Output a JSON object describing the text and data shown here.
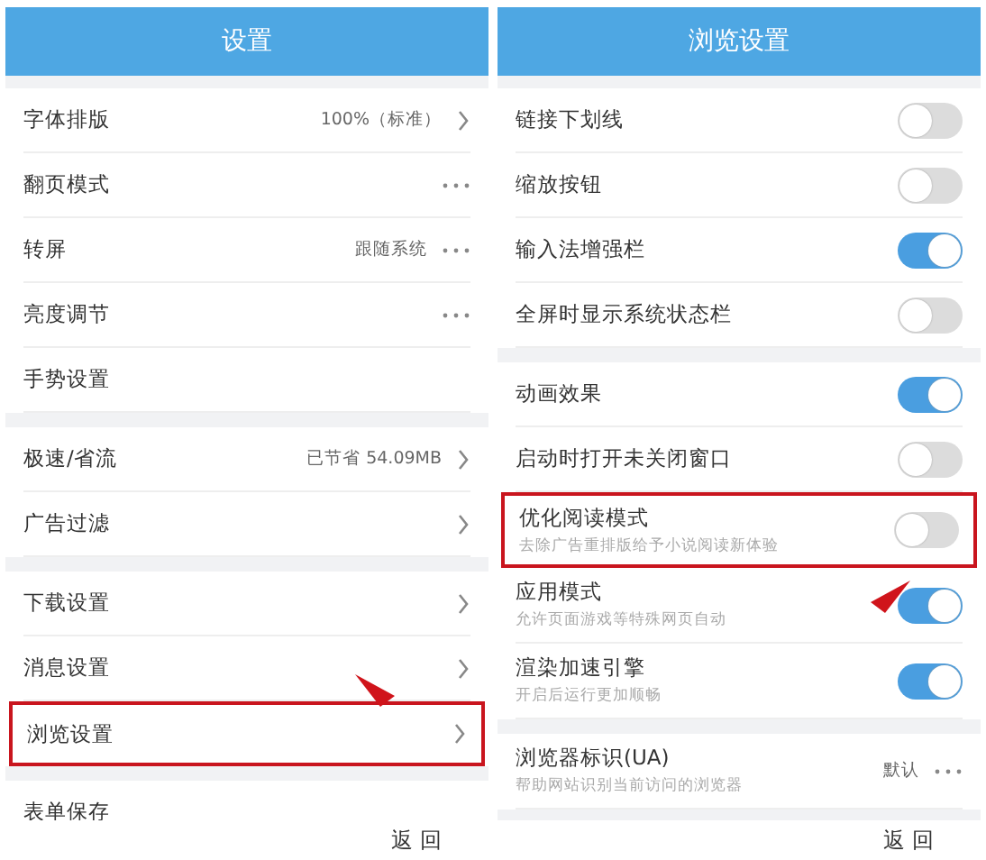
{
  "panels": [
    {
      "title": "设置",
      "footer": "返 回",
      "sections": [
        {
          "rows": [
            {
              "kind": "link",
              "label": "字体排版",
              "value": "100%（标准）",
              "highlighted": false
            },
            {
              "kind": "menu",
              "label": "翻页模式",
              "highlighted": false
            },
            {
              "kind": "menu",
              "label": "转屏",
              "value": "跟随系统",
              "highlighted": false
            },
            {
              "kind": "menu",
              "label": "亮度调节",
              "highlighted": false
            },
            {
              "kind": "plain",
              "label": "手势设置",
              "highlighted": false
            }
          ]
        },
        {
          "rows": [
            {
              "kind": "link",
              "label": "极速/省流",
              "value": "已节省 54.09MB",
              "highlighted": false
            },
            {
              "kind": "link",
              "label": "广告过滤",
              "highlighted": false
            }
          ]
        },
        {
          "rows": [
            {
              "kind": "link",
              "label": "下载设置",
              "highlighted": false
            },
            {
              "kind": "link",
              "label": "消息设置",
              "highlighted": false
            },
            {
              "kind": "link",
              "label": "浏览设置",
              "highlighted": true
            }
          ]
        },
        {
          "rows": [
            {
              "kind": "plain",
              "label": "表单保存",
              "highlighted": false
            }
          ]
        }
      ]
    },
    {
      "title": "浏览设置",
      "footer": "返 回",
      "sections": [
        {
          "rows": [
            {
              "kind": "toggle",
              "label": "链接下划线",
              "on": false,
              "highlighted": false
            },
            {
              "kind": "toggle",
              "label": "缩放按钮",
              "on": false,
              "highlighted": false
            },
            {
              "kind": "toggle",
              "label": "输入法增强栏",
              "on": true,
              "highlighted": false
            },
            {
              "kind": "toggle",
              "label": "全屏时显示系统状态栏",
              "on": false,
              "highlighted": false
            }
          ]
        },
        {
          "rows": [
            {
              "kind": "toggle",
              "label": "动画效果",
              "on": true,
              "highlighted": false
            },
            {
              "kind": "toggle",
              "label": "启动时打开未关闭窗口",
              "on": false,
              "highlighted": false
            },
            {
              "kind": "toggle",
              "label": "优化阅读模式",
              "sublabel": "去除广告重排版给予小说阅读新体验",
              "on": false,
              "highlighted": true
            },
            {
              "kind": "toggle",
              "label": "应用模式",
              "sublabel": "允许页面游戏等特殊网页自动",
              "on": true,
              "highlighted": false
            },
            {
              "kind": "toggle",
              "label": "渲染加速引擎",
              "sublabel": "开启后运行更加顺畅",
              "on": true,
              "highlighted": false
            }
          ]
        },
        {
          "rows": [
            {
              "kind": "menu",
              "label": "浏览器标识(UA)",
              "sublabel": "帮助网站识别当前访问的浏览器",
              "value": "默认",
              "highlighted": false
            }
          ]
        }
      ]
    }
  ]
}
